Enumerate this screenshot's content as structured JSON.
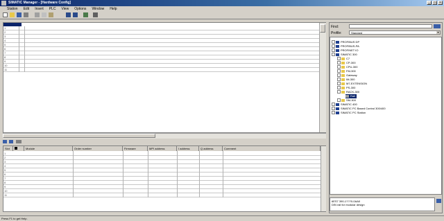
{
  "window": {
    "title": "SIMATIC Manager - [Hardware Config]",
    "app_icon": "app-icon"
  },
  "menu": [
    "Station",
    "Edit",
    "Insert",
    "PLC",
    "View",
    "Options",
    "Window",
    "Help"
  ],
  "toolbar_icons": [
    "new-icon",
    "open-icon",
    "save-icon",
    "print-icon",
    "cut-icon",
    "copy-icon",
    "paste-icon",
    "download-icon",
    "upload-icon",
    "catalog-icon",
    "help-icon"
  ],
  "top_table": {
    "rows": [
      "1",
      "2",
      "3",
      "4",
      "5",
      "6",
      "7",
      "8",
      "9",
      "10",
      "11"
    ]
  },
  "bottom_table": {
    "columns": [
      "Slot",
      "",
      "Module",
      "Order number",
      "Firmware",
      "MPI address",
      "I address",
      "Q address",
      "Comment"
    ],
    "rows": [
      "1",
      "2",
      "3",
      "4",
      "5",
      "6",
      "7",
      "8",
      "9",
      "10",
      "11"
    ]
  },
  "catalog": {
    "find_label": "Find:",
    "profile_label": "Profile:",
    "profile_value": "Standard",
    "items": [
      {
        "label": "PROFIBUS DP",
        "level": 0,
        "color": "#1f3f8f"
      },
      {
        "label": "PROFIBUS-PA",
        "level": 0,
        "color": "#1f3f8f"
      },
      {
        "label": "PROFINET IO",
        "level": 0,
        "color": "#1f3f8f"
      },
      {
        "label": "SIMATIC 300",
        "level": 0,
        "color": "#1f3f8f"
      },
      {
        "label": "C7",
        "level": 1,
        "color": "#e8c84a"
      },
      {
        "label": "CP-300",
        "level": 1,
        "color": "#e8c84a"
      },
      {
        "label": "CPU-300",
        "level": 1,
        "color": "#e8c84a"
      },
      {
        "label": "FM-300",
        "level": 1,
        "color": "#e8c84a"
      },
      {
        "label": "Gateway",
        "level": 1,
        "color": "#e8c84a"
      },
      {
        "label": "IM-300",
        "level": 1,
        "color": "#e8c84a"
      },
      {
        "label": "M7-EXTENSION",
        "level": 1,
        "color": "#e8c84a"
      },
      {
        "label": "PS-300",
        "level": 1,
        "color": "#e8c84a"
      },
      {
        "label": "RACK-300",
        "level": 1,
        "color": "#e8c84a"
      },
      {
        "label": "Rail",
        "level": 2,
        "color": "#a0a0a0"
      },
      {
        "label": "SM-300",
        "level": 1,
        "color": "#e8c84a"
      },
      {
        "label": "SIMATIC 400",
        "level": 0,
        "color": "#1f3f8f"
      },
      {
        "label": "SIMATIC PC Based Control 300/400",
        "level": 0,
        "color": "#1f3f8f"
      },
      {
        "label": "SIMATIC PC Station",
        "level": 0,
        "color": "#1f3f8f"
      }
    ],
    "info_line1": "6ES7 390-1???0-0AA0",
    "info_line2": "DIN rail for modular design"
  },
  "status": {
    "text": "Press F1 to get Help."
  }
}
